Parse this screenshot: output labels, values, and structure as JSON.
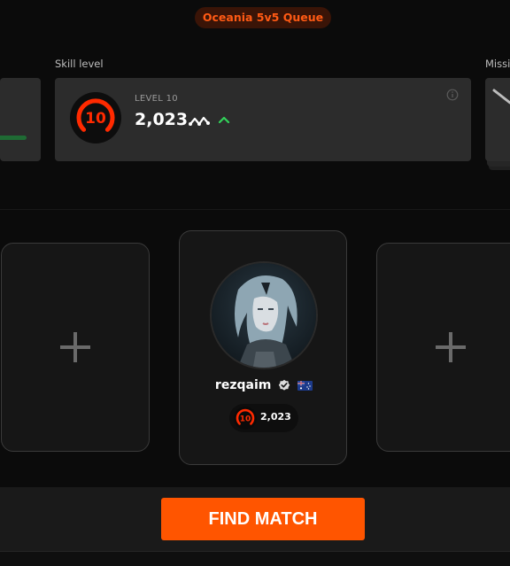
{
  "queue": {
    "label": "Oceania 5v5 Queue"
  },
  "skill": {
    "section_label": "Skill level",
    "level_label": "LEVEL 10",
    "level_number": "10",
    "elo": "2,023"
  },
  "missions": {
    "section_label": "Missi"
  },
  "player": {
    "name": "rezqaim",
    "level": "10",
    "elo": "2,023"
  },
  "footer": {
    "find_match_label": "FIND MATCH"
  },
  "colors": {
    "accent": "#ff5500",
    "level_red": "#ff2a00",
    "trend_green": "#32d35a"
  }
}
